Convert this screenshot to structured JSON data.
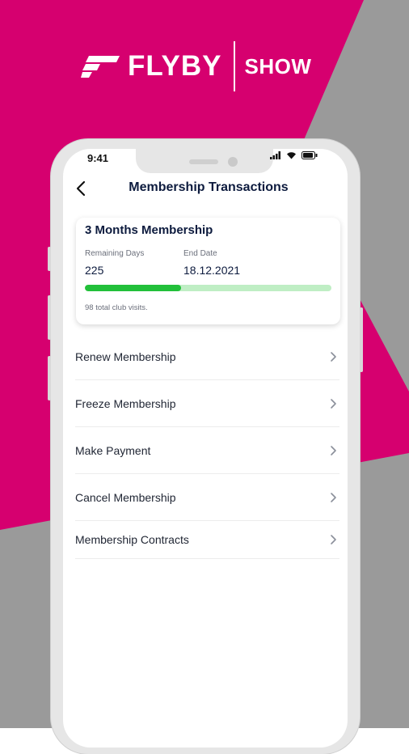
{
  "brand": {
    "name": "FLYBY",
    "tag": "SHOW"
  },
  "colors": {
    "magenta": "#d6006f",
    "gray": "#9a9a9a",
    "progress": "#22c03a",
    "progress_track": "#bfeec4"
  },
  "status_bar": {
    "time": "9:41",
    "icons": [
      "signal-icon",
      "wifi-icon",
      "battery-icon"
    ]
  },
  "header": {
    "title": "Membership Transactions",
    "back_icon": "chevron-left-icon"
  },
  "membership": {
    "title": "3 Months Membership",
    "remaining_label": "Remaining Days",
    "remaining_value": "225",
    "end_label": "End Date",
    "end_value": "18.12.2021",
    "progress": 0.39,
    "visits_text": "98 total club visits."
  },
  "menu": {
    "items": [
      {
        "label": "Renew Membership"
      },
      {
        "label": "Freeze Membership"
      },
      {
        "label": "Make Payment"
      },
      {
        "label": "Cancel Membership"
      },
      {
        "label": "Membership Contracts"
      }
    ]
  }
}
